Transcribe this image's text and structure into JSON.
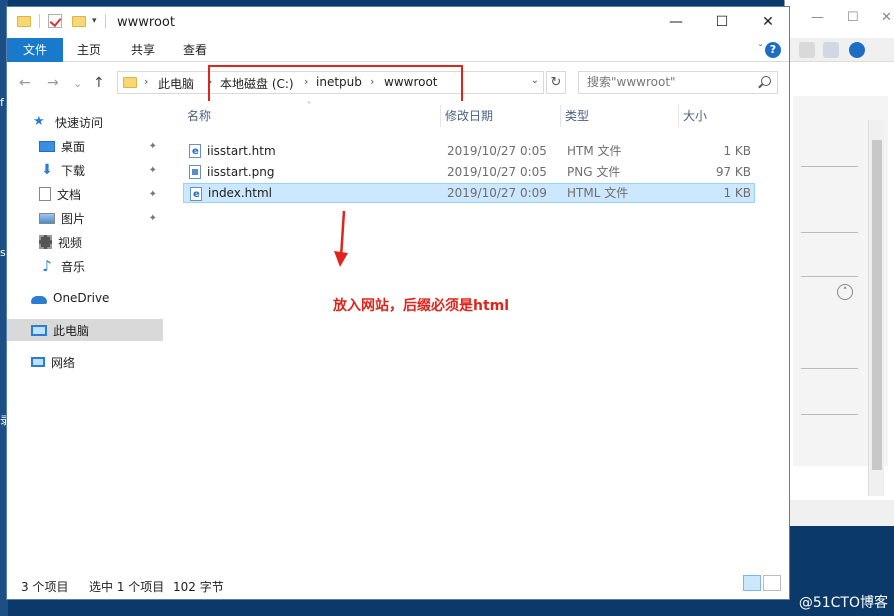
{
  "window": {
    "title": "wwwroot"
  },
  "title_controls": {
    "minimize": "—",
    "maximize": "☐",
    "close": "✕"
  },
  "ribbon": {
    "tabs": [
      "文件",
      "主页",
      "共享",
      "查看"
    ],
    "collapse": "ˇ",
    "help": "?"
  },
  "nav": {
    "back": "←",
    "forward": "→",
    "recent": "⌄",
    "up": "↑",
    "breadcrumb": [
      "此电脑",
      "本地磁盘 (C:)",
      "inetpub",
      "wwwroot"
    ],
    "dropdown": "⌄",
    "refresh": "↻",
    "search_placeholder": "搜索\"wwwroot\""
  },
  "sidebar": {
    "items": [
      {
        "label": "快速访问",
        "icon": "star-icon",
        "pinned": false
      },
      {
        "label": "桌面",
        "icon": "desktop-icon",
        "pinned": true
      },
      {
        "label": "下载",
        "icon": "download-icon",
        "pinned": true
      },
      {
        "label": "文档",
        "icon": "document-icon",
        "pinned": true
      },
      {
        "label": "图片",
        "icon": "pictures-icon",
        "pinned": true
      },
      {
        "label": "视频",
        "icon": "video-icon",
        "pinned": false
      },
      {
        "label": "音乐",
        "icon": "music-icon",
        "pinned": false
      },
      {
        "label": "OneDrive",
        "icon": "onedrive-icon",
        "pinned": false
      },
      {
        "label": "此电脑",
        "icon": "computer-icon",
        "pinned": false,
        "selected": true
      },
      {
        "label": "网络",
        "icon": "network-icon",
        "pinned": false
      }
    ],
    "pin_glyph": "📌"
  },
  "columns": {
    "name": "名称",
    "modified": "修改日期",
    "type": "类型",
    "size": "大小"
  },
  "files": [
    {
      "name": "iisstart.htm",
      "modified": "2019/10/27 0:05",
      "type": "HTM 文件",
      "size": "1 KB",
      "icon": "html-file-icon"
    },
    {
      "name": "iisstart.png",
      "modified": "2019/10/27 0:05",
      "type": "PNG 文件",
      "size": "97 KB",
      "icon": "image-file-icon"
    },
    {
      "name": "index.html",
      "modified": "2019/10/27 0:09",
      "type": "HTML 文件",
      "size": "1 KB",
      "icon": "html-file-icon",
      "selected": true
    }
  ],
  "annotation": {
    "text": "放入网站，后缀必须是html",
    "color": "#e0241b"
  },
  "status": {
    "count": "3 个项目",
    "selection": "选中 1 个项目",
    "bytes": "102 字节"
  },
  "desktop": {
    "watermark": "@51CTO博客",
    "left_chars": [
      "f",
      "s",
      "录"
    ]
  },
  "accent": "#1979ca"
}
